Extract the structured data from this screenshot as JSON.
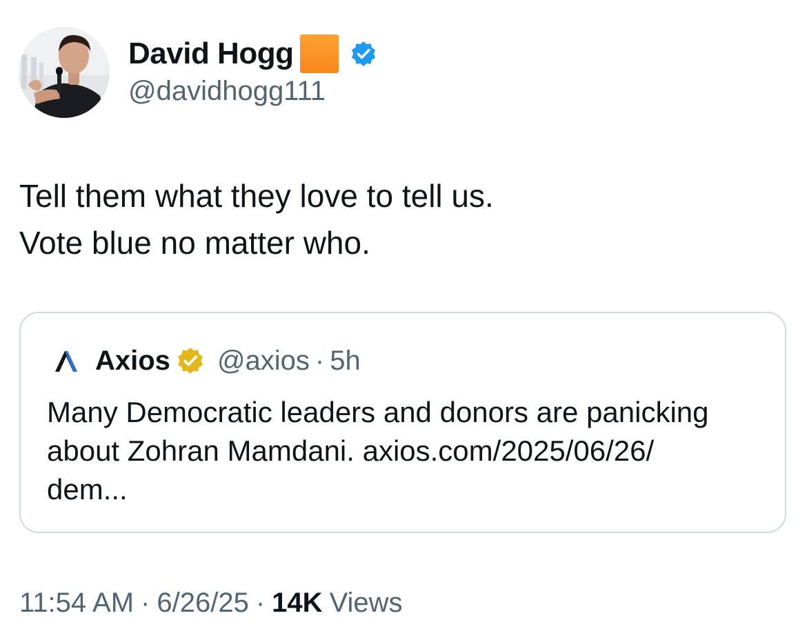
{
  "author": {
    "name": "David Hogg",
    "name_emoji": "🟧",
    "handle": "@davidhogg111",
    "verified_badge_color": "#1d9bf0",
    "avatar": "avatar"
  },
  "tweet": {
    "lines": [
      "Tell them what they love to tell us.",
      "Vote blue no matter who."
    ]
  },
  "quote": {
    "logo": "axios-logo",
    "name": "Axios",
    "verified_badge_color": "#e2b719",
    "handle": "@axios",
    "separator": "·",
    "time": "5h",
    "lines": [
      "Many Democratic leaders and donors are panicking",
      "about Zohran Mamdani. axios.com/2025/06/26/",
      "dem..."
    ]
  },
  "meta": {
    "time": "11:54 AM",
    "separator": "·",
    "date": "6/26/25",
    "views_count": "14K",
    "views_label": "Views"
  },
  "colors": {
    "text_primary": "#0f1419",
    "text_secondary": "#536471",
    "border": "#cfd9de",
    "orange_square": "#f7861c"
  }
}
